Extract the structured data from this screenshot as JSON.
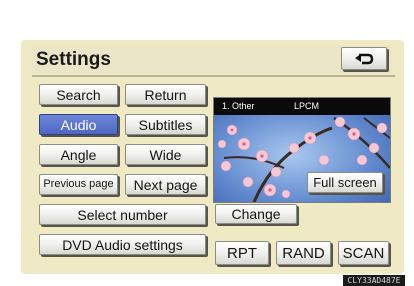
{
  "screen": {
    "title": "Settings",
    "back_icon": "return-arrow-icon"
  },
  "buttons": {
    "search": "Search",
    "return": "Return",
    "audio": "Audio",
    "subtitles": "Subtitles",
    "angle": "Angle",
    "wide": "Wide",
    "previous_page": "Previous page",
    "next_page": "Next page",
    "select_number": "Select number",
    "dvd_audio_settings": "DVD Audio settings",
    "change": "Change",
    "full_screen": "Full screen",
    "rpt": "RPT",
    "rand": "RAND",
    "scan": "SCAN"
  },
  "video": {
    "track": "1. Other",
    "format": "LPCM"
  },
  "footer": {
    "catalog_code": "CLY33AD487E"
  },
  "colors": {
    "screen_bg": "#efe9c4",
    "active_button": "#4d67c4",
    "button_shadow": "#57544a"
  }
}
